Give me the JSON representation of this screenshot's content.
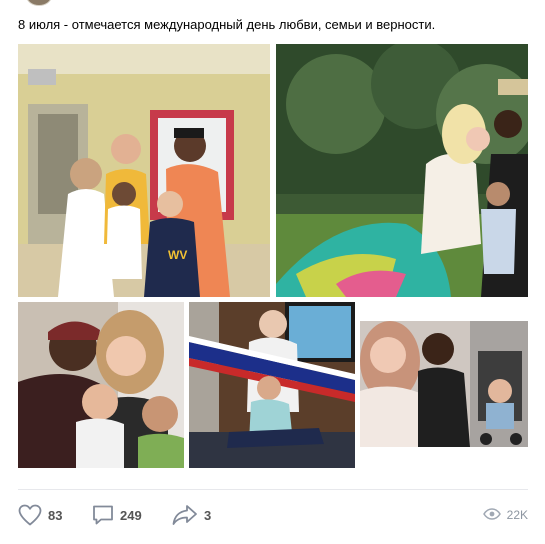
{
  "post": {
    "text": "8 июля - отмечается международный день любви, семьи и верности."
  },
  "photos": [
    {
      "description_icon": "family-photo-indoors"
    },
    {
      "description_icon": "couple-kiss-outdoors"
    },
    {
      "description_icon": "family-selfie"
    },
    {
      "description_icon": "family-with-flag"
    },
    {
      "description_icon": "family-with-stroller"
    }
  ],
  "footer": {
    "likes": "83",
    "comments": "249",
    "shares": "3",
    "views": "22K"
  },
  "colors": {
    "icon_gray": "#828a99",
    "text_gray": "#656565",
    "views_gray": "#a0a8b3",
    "divider": "#e7e8ec"
  }
}
